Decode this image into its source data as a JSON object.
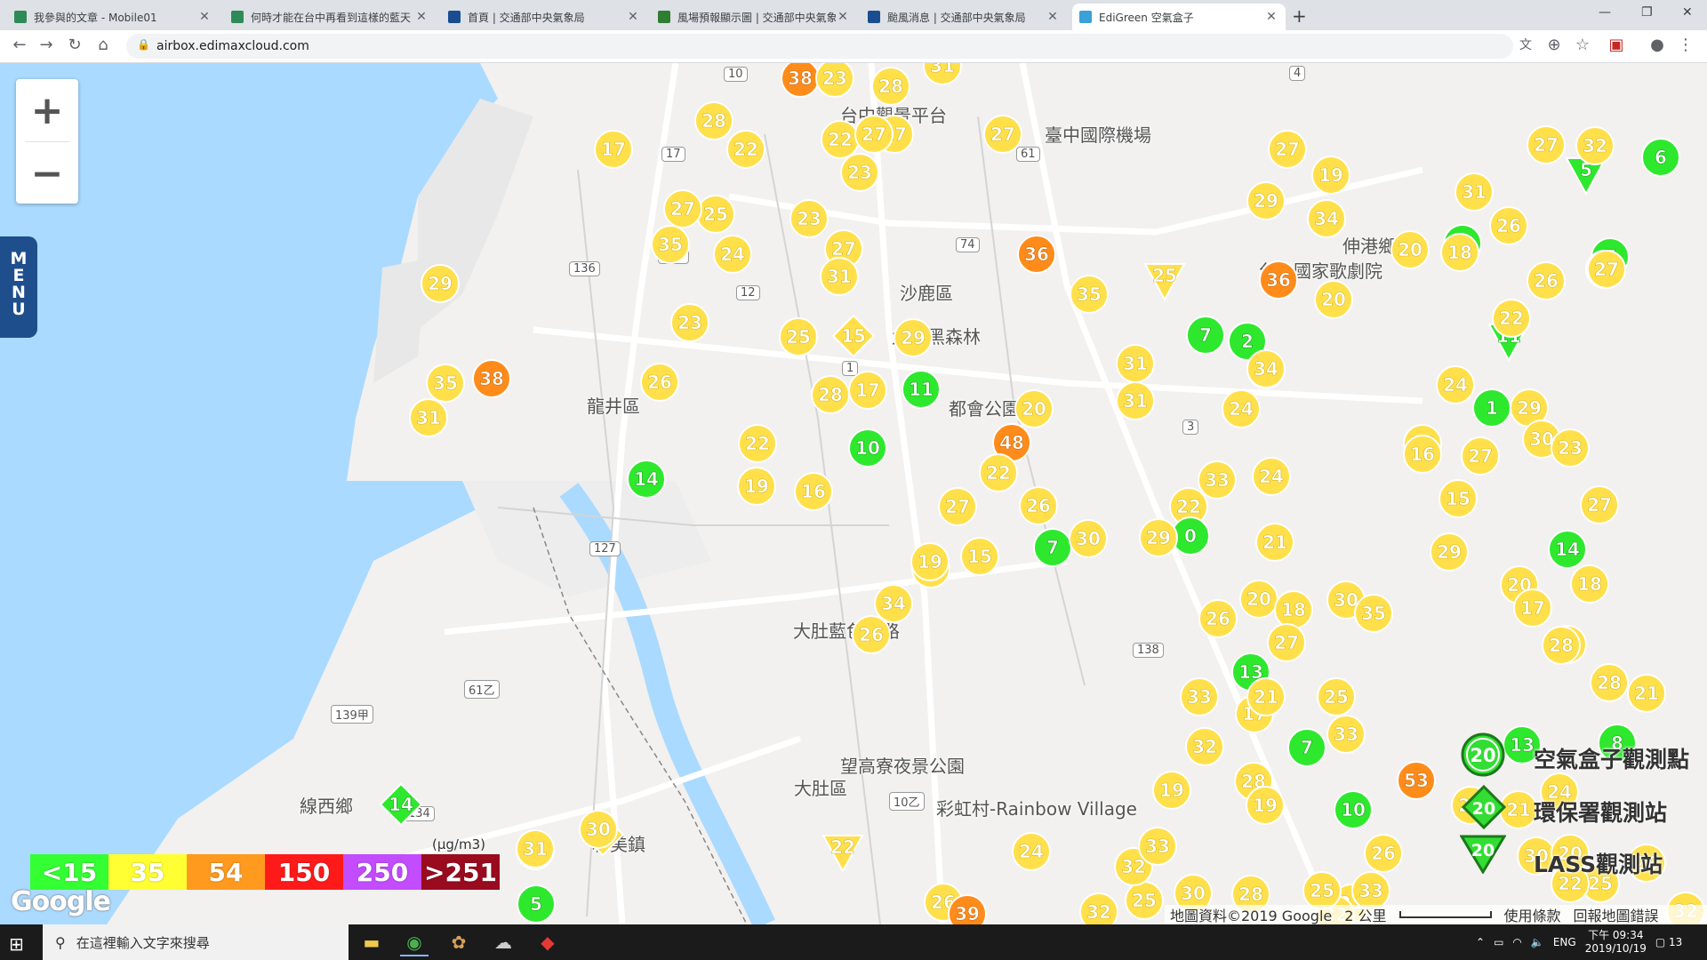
{
  "tabs": [
    {
      "title": "我參與的文章 - Mobile01",
      "fav": "#2e8b57",
      "active": false
    },
    {
      "title": "何時才能在台中再看到這樣的藍天",
      "fav": "#2e8b57",
      "active": false
    },
    {
      "title": "首頁 | 交通部中央氣象局",
      "fav": "#1a4d8f",
      "active": false
    },
    {
      "title": "風場預報顯示圖 | 交通部中央氣象局",
      "fav": "#2e7d32",
      "active": false
    },
    {
      "title": "颱風消息 | 交通部中央氣象局",
      "fav": "#1a4d8f",
      "active": false
    },
    {
      "title": "EdiGreen 空氣盒子",
      "fav": "#3aa0d8",
      "active": true
    }
  ],
  "address": {
    "url": "airbox.edimaxcloud.com"
  },
  "zoom": {
    "in_label": "+",
    "out_label": "−"
  },
  "menu": {
    "label": "MENU"
  },
  "legend": {
    "unit": "(μg/m3)",
    "items": [
      {
        "label": "<15",
        "color": "#33ff33"
      },
      {
        "label": "35",
        "color": "#ffff33"
      },
      {
        "label": "54",
        "color": "#ff9a1f"
      },
      {
        "label": "150",
        "color": "#ff1a1a"
      },
      {
        "label": "250",
        "color": "#c34cff"
      },
      {
        "label": ">251",
        "color": "#9a0b1f"
      }
    ]
  },
  "station_legend": {
    "airbox": {
      "value": "20",
      "label": "空氣盒子觀測點"
    },
    "epa": {
      "value": "20",
      "label": "環保署觀測站"
    },
    "lass": {
      "value": "20",
      "label": "LASS觀測站"
    }
  },
  "places": [
    {
      "name": "沙鹿區"
    },
    {
      "name": "龍井區"
    },
    {
      "name": "大肚區"
    },
    {
      "name": "線西鄉"
    },
    {
      "name": "伸港鄉"
    },
    {
      "name": "臺中國際機場"
    },
    {
      "name": "都會公園"
    },
    {
      "name": "望高寮夜景公園"
    },
    {
      "name": "彩虹村-Rainbow Village"
    },
    {
      "name": "九天黑森林"
    },
    {
      "name": "大肚藍色公路"
    },
    {
      "name": "和美鎮"
    },
    {
      "name": "台中觀景平台"
    },
    {
      "name": "台中國家歌劇院"
    }
  ],
  "road_shields": [
    "10",
    "17",
    "61",
    "136",
    "139",
    "12",
    "1",
    "127",
    "3",
    "74",
    "138",
    "134",
    "61乙",
    "10乙",
    "139甲",
    "4"
  ],
  "attribution": {
    "data": "地圖資料©2019 Google",
    "scale": "2 公里",
    "terms": "使用條款",
    "report": "回報地圖錯誤"
  },
  "google_logo": "Google",
  "taskbar": {
    "search_placeholder": "在這裡輸入文字來搜尋",
    "time": "下午 09:34",
    "date": "2019/10/19",
    "lang": "ENG",
    "notify": "13"
  },
  "markers": [
    {
      "v": 38,
      "t": "c"
    },
    {
      "v": 23,
      "t": "c"
    },
    {
      "v": 28,
      "t": "c"
    },
    {
      "v": 31,
      "t": "c"
    },
    {
      "v": 27,
      "t": "c"
    },
    {
      "v": 17,
      "t": "c"
    },
    {
      "v": 28,
      "t": "c"
    },
    {
      "v": 22,
      "t": "c"
    },
    {
      "v": 22,
      "t": "c"
    },
    {
      "v": 27,
      "t": "c"
    },
    {
      "v": 27,
      "t": "c"
    },
    {
      "v": 23,
      "t": "c"
    },
    {
      "v": 25,
      "t": "c"
    },
    {
      "v": 27,
      "t": "c"
    },
    {
      "v": 23,
      "t": "c"
    },
    {
      "v": 35,
      "t": "c"
    },
    {
      "v": 24,
      "t": "c"
    },
    {
      "v": 27,
      "t": "c"
    },
    {
      "v": 31,
      "t": "c"
    },
    {
      "v": 36,
      "t": "c"
    },
    {
      "v": 29,
      "t": "c"
    },
    {
      "v": 23,
      "t": "c"
    },
    {
      "v": 25,
      "t": "c"
    },
    {
      "v": 15,
      "t": "d"
    },
    {
      "v": 29,
      "t": "c"
    },
    {
      "v": 35,
      "t": "c"
    },
    {
      "v": 38,
      "t": "c"
    },
    {
      "v": 31,
      "t": "c"
    },
    {
      "v": 26,
      "t": "c"
    },
    {
      "v": 28,
      "t": "c"
    },
    {
      "v": 17,
      "t": "c"
    },
    {
      "v": 11,
      "t": "c"
    },
    {
      "v": 20,
      "t": "c"
    },
    {
      "v": 14,
      "t": "c"
    },
    {
      "v": 22,
      "t": "c"
    },
    {
      "v": 10,
      "t": "c"
    },
    {
      "v": 19,
      "t": "c"
    },
    {
      "v": 16,
      "t": "c"
    },
    {
      "v": 48,
      "t": "c"
    },
    {
      "v": 22,
      "t": "c"
    },
    {
      "v": 26,
      "t": "c"
    },
    {
      "v": 27,
      "t": "c"
    },
    {
      "v": 31,
      "t": "c"
    },
    {
      "v": 19,
      "t": "c"
    },
    {
      "v": 15,
      "t": "c"
    },
    {
      "v": 7,
      "t": "c"
    },
    {
      "v": 30,
      "t": "c"
    },
    {
      "v": 34,
      "t": "c"
    },
    {
      "v": 26,
      "t": "c"
    },
    {
      "v": 13,
      "t": "c"
    },
    {
      "v": 15,
      "t": "d"
    },
    {
      "v": 14,
      "t": "d"
    },
    {
      "v": 31,
      "t": "c"
    },
    {
      "v": 30,
      "t": "c"
    },
    {
      "v": 5,
      "t": "c"
    },
    {
      "v": 22,
      "t": "t"
    },
    {
      "v": 26,
      "t": "c"
    },
    {
      "v": 39,
      "t": "c"
    },
    {
      "v": 35,
      "t": "c"
    },
    {
      "v": 25,
      "t": "t"
    },
    {
      "v": 31,
      "t": "c"
    },
    {
      "v": 31,
      "t": "c"
    },
    {
      "v": 7,
      "t": "c"
    },
    {
      "v": 2,
      "t": "c"
    },
    {
      "v": 32,
      "t": "c"
    },
    {
      "v": 24,
      "t": "c"
    },
    {
      "v": 34,
      "t": "c"
    },
    {
      "v": 29,
      "t": "c"
    },
    {
      "v": 27,
      "t": "c"
    },
    {
      "v": 19,
      "t": "c"
    },
    {
      "v": 34,
      "t": "c"
    },
    {
      "v": 36,
      "t": "c"
    },
    {
      "v": 20,
      "t": "c"
    },
    {
      "v": 24,
      "t": "c"
    },
    {
      "v": 33,
      "t": "c"
    },
    {
      "v": 22,
      "t": "c"
    },
    {
      "v": 21,
      "t": "c"
    },
    {
      "v": 0,
      "t": "c"
    },
    {
      "v": 29,
      "t": "c"
    },
    {
      "v": 20,
      "t": "c"
    },
    {
      "v": 18,
      "t": "c"
    },
    {
      "v": 30,
      "t": "c"
    },
    {
      "v": 26,
      "t": "c"
    },
    {
      "v": 27,
      "t": "c"
    },
    {
      "v": 35,
      "t": "c"
    },
    {
      "v": 33,
      "t": "c"
    },
    {
      "v": 13,
      "t": "c"
    },
    {
      "v": 17,
      "t": "c"
    },
    {
      "v": 21,
      "t": "c"
    },
    {
      "v": 25,
      "t": "c"
    },
    {
      "v": 33,
      "t": "c"
    },
    {
      "v": 7,
      "t": "c"
    },
    {
      "v": 32,
      "t": "c"
    },
    {
      "v": 19,
      "t": "c"
    },
    {
      "v": 28,
      "t": "c"
    },
    {
      "v": 19,
      "t": "c"
    },
    {
      "v": 10,
      "t": "c"
    },
    {
      "v": 53,
      "t": "c"
    },
    {
      "v": 26,
      "t": "c"
    },
    {
      "v": 31,
      "t": "c"
    },
    {
      "v": 22,
      "t": "c"
    },
    {
      "v": 28,
      "t": "c"
    },
    {
      "v": 25,
      "t": "c"
    },
    {
      "v": 32,
      "t": "c"
    },
    {
      "v": 24,
      "t": "c"
    },
    {
      "v": 33,
      "t": "c"
    },
    {
      "v": 30,
      "t": "c"
    },
    {
      "v": 32,
      "t": "c"
    },
    {
      "v": 25,
      "t": "c"
    },
    {
      "v": 33,
      "t": "c"
    },
    {
      "v": 20,
      "t": "c"
    },
    {
      "v": 31,
      "t": "c"
    },
    {
      "v": 0,
      "t": "c"
    },
    {
      "v": 26,
      "t": "c"
    },
    {
      "v": 18,
      "t": "c"
    },
    {
      "v": 26,
      "t": "c"
    },
    {
      "v": 11,
      "t": "t"
    },
    {
      "v": 5,
      "t": "t"
    },
    {
      "v": 27,
      "t": "c"
    },
    {
      "v": 32,
      "t": "c"
    },
    {
      "v": 22,
      "t": "c"
    },
    {
      "v": 7,
      "t": "c"
    },
    {
      "v": 6,
      "t": "c"
    },
    {
      "v": 25,
      "t": "c"
    },
    {
      "v": 27,
      "t": "c"
    },
    {
      "v": 24,
      "t": "c"
    },
    {
      "v": 29,
      "t": "c"
    },
    {
      "v": 1,
      "t": "c"
    },
    {
      "v": 30,
      "t": "c"
    },
    {
      "v": 26,
      "t": "c"
    },
    {
      "v": 27,
      "t": "c"
    },
    {
      "v": 15,
      "t": "c"
    },
    {
      "v": 16,
      "t": "c"
    },
    {
      "v": 29,
      "t": "c"
    },
    {
      "v": 23,
      "t": "c"
    },
    {
      "v": 18,
      "t": "c"
    },
    {
      "v": 27,
      "t": "c"
    },
    {
      "v": 14,
      "t": "c"
    },
    {
      "v": 20,
      "t": "c"
    },
    {
      "v": 17,
      "t": "c"
    },
    {
      "v": 33,
      "t": "c"
    },
    {
      "v": 28,
      "t": "c"
    },
    {
      "v": 8,
      "t": "c"
    },
    {
      "v": 21,
      "t": "c"
    },
    {
      "v": 13,
      "t": "c"
    },
    {
      "v": 30,
      "t": "c"
    },
    {
      "v": 21,
      "t": "c"
    },
    {
      "v": 26,
      "t": "c"
    },
    {
      "v": 28,
      "t": "c"
    },
    {
      "v": 24,
      "t": "c"
    },
    {
      "v": 32,
      "t": "c"
    },
    {
      "v": 26,
      "t": "c"
    },
    {
      "v": 25,
      "t": "c"
    },
    {
      "v": 22,
      "t": "c"
    },
    {
      "v": 20,
      "t": "c"
    }
  ]
}
